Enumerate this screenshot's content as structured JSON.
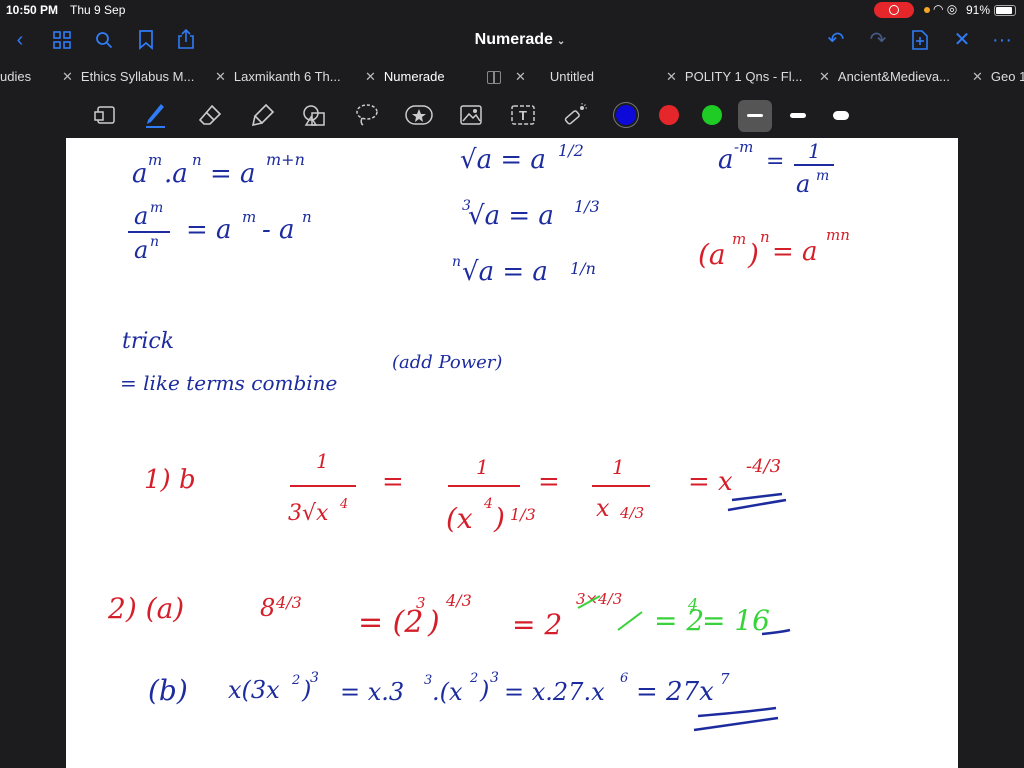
{
  "status": {
    "time": "10:50 PM",
    "date": "Thu 9 Sep",
    "battery": "91%"
  },
  "nav": {
    "title": "Numerade"
  },
  "tabs": [
    {
      "label": "udies"
    },
    {
      "label": "Ethics Syllabus M..."
    },
    {
      "label": "Laxmikanth 6 Th..."
    },
    {
      "label": "Numerade"
    },
    {
      "label": "Untitled"
    },
    {
      "label": "POLITY 1 Qns - Fl..."
    },
    {
      "label": "Ancient&Medieva..."
    },
    {
      "label": "Geo 1"
    }
  ],
  "toolbar": {
    "tools": [
      "page-icon",
      "pen-icon",
      "eraser-icon",
      "highlighter-icon",
      "shapes-icon",
      "lasso-icon",
      "sticker-icon",
      "image-icon",
      "text-icon",
      "laser-pointer-icon"
    ],
    "colors": [
      "#0d0ad9",
      "#e5262b",
      "#1fcb25"
    ],
    "selected_color": "#0d0ad9",
    "selected_thickness": 1
  },
  "notes": {
    "r1a": "a",
    "r1b": "m",
    "r1c": ".a",
    "r1d": "n",
    "r1e": "= a",
    "r1f": "m+n",
    "sqrt": "√a = a",
    "half": "1/2",
    "neg_a": "a",
    "neg_m": "-m",
    "eq1": "=",
    "one": "1",
    "am": "a",
    "am_m": "m",
    "div_num": "a",
    "div_num_m": "m",
    "div_den": "a",
    "div_den_n": "n",
    "div_res": "= a",
    "div_res_m": "m",
    "div_minus": "- a",
    "div_n": "n",
    "cbrt_idx": "3",
    "cbrt": "√a  = a",
    "third": "1/3",
    "pow_l": "(a",
    "pow_m": "m",
    "pow_r": ")",
    "pow_n": "n",
    "pow_eq": "= a",
    "pow_mn": "mn",
    "nrt_idx": "n",
    "nrt": "√a  = a",
    "nth": "1/n",
    "trick": "trick",
    "like": "=   like terms combine",
    "add": "(add Power)",
    "q1": "1) b",
    "f1n": "1",
    "f1d": "3√x",
    "f1d4": "4",
    "f_eq": "=",
    "f2n": "1",
    "f2d": "(x",
    "f2d4": "4",
    "f2dc": ")",
    "f2p": "1/3",
    "f_eq2": "=",
    "f3n": "1",
    "f3d": "x",
    "f3p": "4/3",
    "f_eq3": "= x",
    "f_res": "-4/3",
    "q2": "2) (a)",
    "e8": "8",
    "e8p": "4/3",
    "e_eq": "= (2",
    "e_3": "3",
    "e_c": ")",
    "e_43": "4/3",
    "e_eq2": "= 2",
    "e_exp": "3×4/3",
    "g_eq": "= 2",
    "g_4": "4",
    "g_res": "= 16",
    "qb": "(b)",
    "b1": "x(3x",
    "b1_2": "2",
    "b1_c": ")",
    "b1_3": "3",
    "b2": "= x.3",
    "b2_3": "3",
    "b2b": ".(x",
    "b2_2": "2",
    "b2c": ")",
    "b2_3b": "3",
    "b3": "= x.27.x",
    "b3_6": "6",
    "b4": "= 27x",
    "b4_7": "7"
  }
}
